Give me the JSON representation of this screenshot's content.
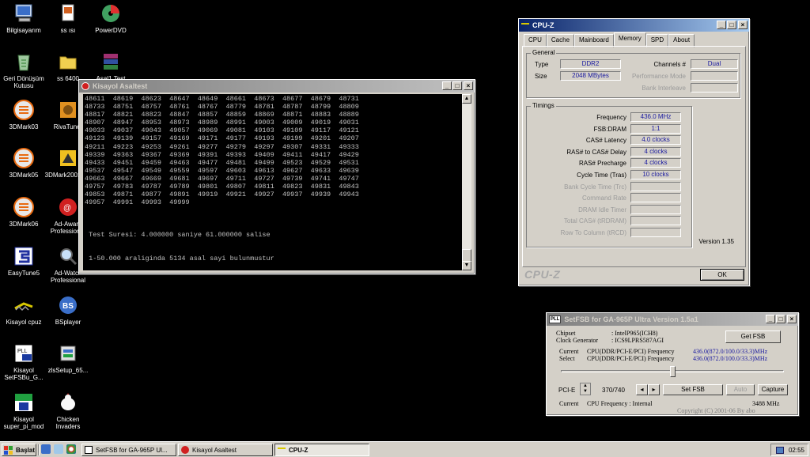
{
  "desktop": {
    "icons": [
      {
        "label": "Bilgisayarım"
      },
      {
        "label": "ss ısı"
      },
      {
        "label": "PowerDVD"
      },
      {
        "label": "Geri Dönüşüm Kutusu"
      },
      {
        "label": "ss 6400"
      },
      {
        "label": "Asal1.Test"
      },
      {
        "label": "3DMark03"
      },
      {
        "label": "RivaTuner"
      },
      {
        "label": "3DMark05"
      },
      {
        "label": "3DMark2001 SE"
      },
      {
        "label": "3DMark06"
      },
      {
        "label": "Ad-Aware Profession..."
      },
      {
        "label": "EasyTune5"
      },
      {
        "label": "Ad-Watch Professional"
      },
      {
        "label": "Kisayol cpuz"
      },
      {
        "label": "BSplayer"
      },
      {
        "label": "Kisayol SetFSBu_G..."
      },
      {
        "label": "zlsSetup_65..."
      },
      {
        "label": "Kisayol super_pi_mod"
      },
      {
        "label": "Chicken Invaders"
      }
    ]
  },
  "console_window": {
    "title": "Kisayol Asaltest",
    "lines": [
      "48611  48619  48623  48647  48649  48661  48673  48677  48679  48731",
      "48733  48751  48757  48761  48767  48779  48781  48787  48799  48809",
      "48817  48821  48823  48847  48857  48859  48869  48871  48883  48889",
      "48907  48947  48953  48973  48989  48991  49003  49009  49019  49031",
      "49033  49037  49043  49057  49069  49081  49103  49109  49117  49121",
      "49123  49139  49157  49169  49171  49177  49193  49199  49201  49207",
      "49211  49223  49253  49261  49277  49279  49297  49307  49331  49333",
      "49339  49363  49367  49369  49391  49393  49409  49411  49417  49429",
      "49433  49451  49459  49463  49477  49481  49499  49523  49529  49531",
      "49537  49547  49549  49559  49597  49603  49613  49627  49633  49639",
      "49663  49667  49669  49681  49697  49711  49727  49739  49741  49747",
      "49757  49783  49787  49789  49801  49807  49811  49823  49831  49843",
      "49853  49871  49877  49891  49919  49921  49927  49937  49939  49943",
      "49957  49991  49993  49999",
      "",
      "",
      "",
      " Test Suresi: 4.000000 saniye 61.000000 salise",
      "",
      "",
      " 1-50.000 araliginda 5134 asal sayi bulunmustur"
    ]
  },
  "cpuz": {
    "title": "CPU-Z",
    "tabs": [
      "CPU",
      "Cache",
      "Mainboard",
      "Memory",
      "SPD",
      "About"
    ],
    "active_tab": "Memory",
    "general_label": "General",
    "type_label": "Type",
    "type_value": "DDR2",
    "size_label": "Size",
    "size_value": "2048 MBytes",
    "channels_label": "Channels #",
    "channels_value": "Dual",
    "perf_mode_label": "Performance Mode",
    "bank_interleave_label": "Bank Interleave",
    "timings_label": "Timings",
    "timings": [
      {
        "label": "Frequency",
        "value": "436.0 MHz"
      },
      {
        "label": "FSB:DRAM",
        "value": "1:1"
      },
      {
        "label": "CAS# Latency",
        "value": "4.0 clocks"
      },
      {
        "label": "RAS# to CAS# Delay",
        "value": "4 clocks"
      },
      {
        "label": "RAS# Precharge",
        "value": "4 clocks"
      },
      {
        "label": "Cycle Time (Tras)",
        "value": "10 clocks"
      },
      {
        "label": "Bank Cycle Time (Trc)",
        "value": ""
      },
      {
        "label": "Command Rate",
        "value": ""
      },
      {
        "label": "DRAM Idle Timer",
        "value": ""
      },
      {
        "label": "Total CAS# (tRDRAM)",
        "value": ""
      },
      {
        "label": "Row To Column (tRCD)",
        "value": ""
      }
    ],
    "version": "Version 1.35",
    "logo": "CPU-Z",
    "ok_label": "OK"
  },
  "setfsb": {
    "title": "SetFSB for GA-965P  Ultra Version 1.5a1",
    "title_icon": "PLL",
    "chipset_label": "Chipset",
    "chipset_value": ": IntelP965(ICH8)",
    "clockgen_label": "Clock Generator",
    "clockgen_value": ": ICS9LPRS587AGI",
    "get_fsb_label": "Get FSB",
    "current_label": "Current",
    "current_text": "CPU(DDR/PCI-E/PCI) Frequency",
    "current_value": "436.0(872.0/100.0/33.3)MHz",
    "select_label": "Select",
    "select_text": "CPU(DDR/PCI-E/PCI) Frequency",
    "select_value": "436.0(872.0/100.0/33.3)MHz",
    "slider_position": 0.5,
    "pcie_label": "PCI-E",
    "counter": "370/740",
    "set_fsb_label": "Set FSB",
    "auto_label": "Auto",
    "capture_label": "Capture",
    "cpu_freq_label": "Current",
    "cpu_freq_text": "CPU Frequency : Internal",
    "cpu_freq_value": "3488 MHz",
    "copyright": "Copyright (C) 2001-06 By abo"
  },
  "taskbar": {
    "start_label": "Başlat",
    "tasks": [
      {
        "label": "SetFSB for GA-965P  Ul..."
      },
      {
        "label": "Kisayol Asaltest"
      },
      {
        "label": "CPU-Z"
      }
    ],
    "clock": "02:55"
  }
}
